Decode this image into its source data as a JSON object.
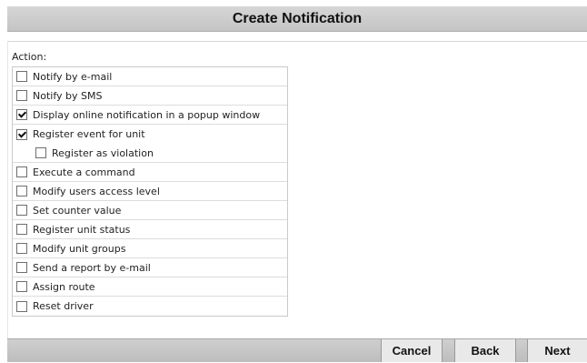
{
  "dialog": {
    "title": "Create Notification",
    "action_label": "Action:",
    "actions": [
      {
        "label": "Notify by e-mail",
        "checked": false
      },
      {
        "label": "Notify by SMS",
        "checked": false
      },
      {
        "label": "Display online notification in a popup window",
        "checked": true
      },
      {
        "label": "Register event for unit",
        "checked": true
      },
      {
        "label": "Register as violation",
        "checked": false,
        "sub": true
      },
      {
        "label": "Execute a command",
        "checked": false
      },
      {
        "label": "Modify users access level",
        "checked": false
      },
      {
        "label": "Set counter value",
        "checked": false
      },
      {
        "label": "Register unit status",
        "checked": false
      },
      {
        "label": "Modify unit groups",
        "checked": false
      },
      {
        "label": "Send a report by e-mail",
        "checked": false
      },
      {
        "label": "Assign route",
        "checked": false
      },
      {
        "label": "Reset driver",
        "checked": false
      }
    ],
    "buttons": {
      "cancel": "Cancel",
      "back": "Back",
      "next": "Next"
    }
  }
}
